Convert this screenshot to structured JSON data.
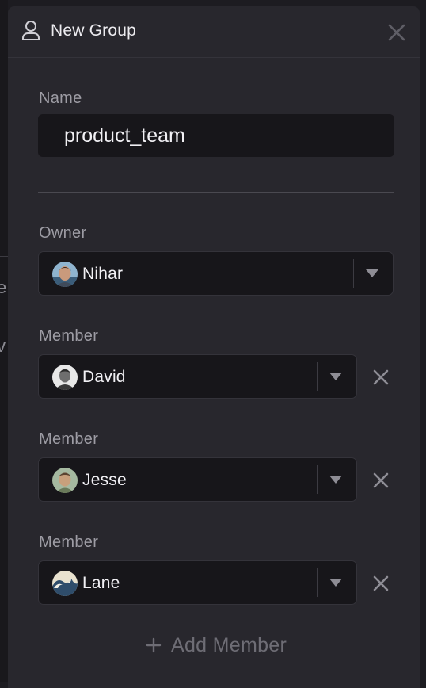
{
  "background": {
    "glyphs": [
      "e",
      "v"
    ]
  },
  "dialog": {
    "title": "New Group",
    "icon": "user-outline-icon",
    "close_icon": "close-icon"
  },
  "form": {
    "name_label": "Name",
    "name_value": "product_team",
    "owner": {
      "label": "Owner",
      "value": "Nihar",
      "avatar": "avatar-nihar"
    },
    "members": [
      {
        "label": "Member",
        "value": "David",
        "avatar": "avatar-david"
      },
      {
        "label": "Member",
        "value": "Jesse",
        "avatar": "avatar-jesse"
      },
      {
        "label": "Member",
        "value": "Lane",
        "avatar": "avatar-lane"
      }
    ],
    "add_member_label": "Add Member"
  },
  "colors": {
    "dialog_bg": "#28272d",
    "field_bg": "#17161a",
    "text": "#ecebef",
    "label": "#9d9ca4",
    "muted": "#6e6d75"
  }
}
